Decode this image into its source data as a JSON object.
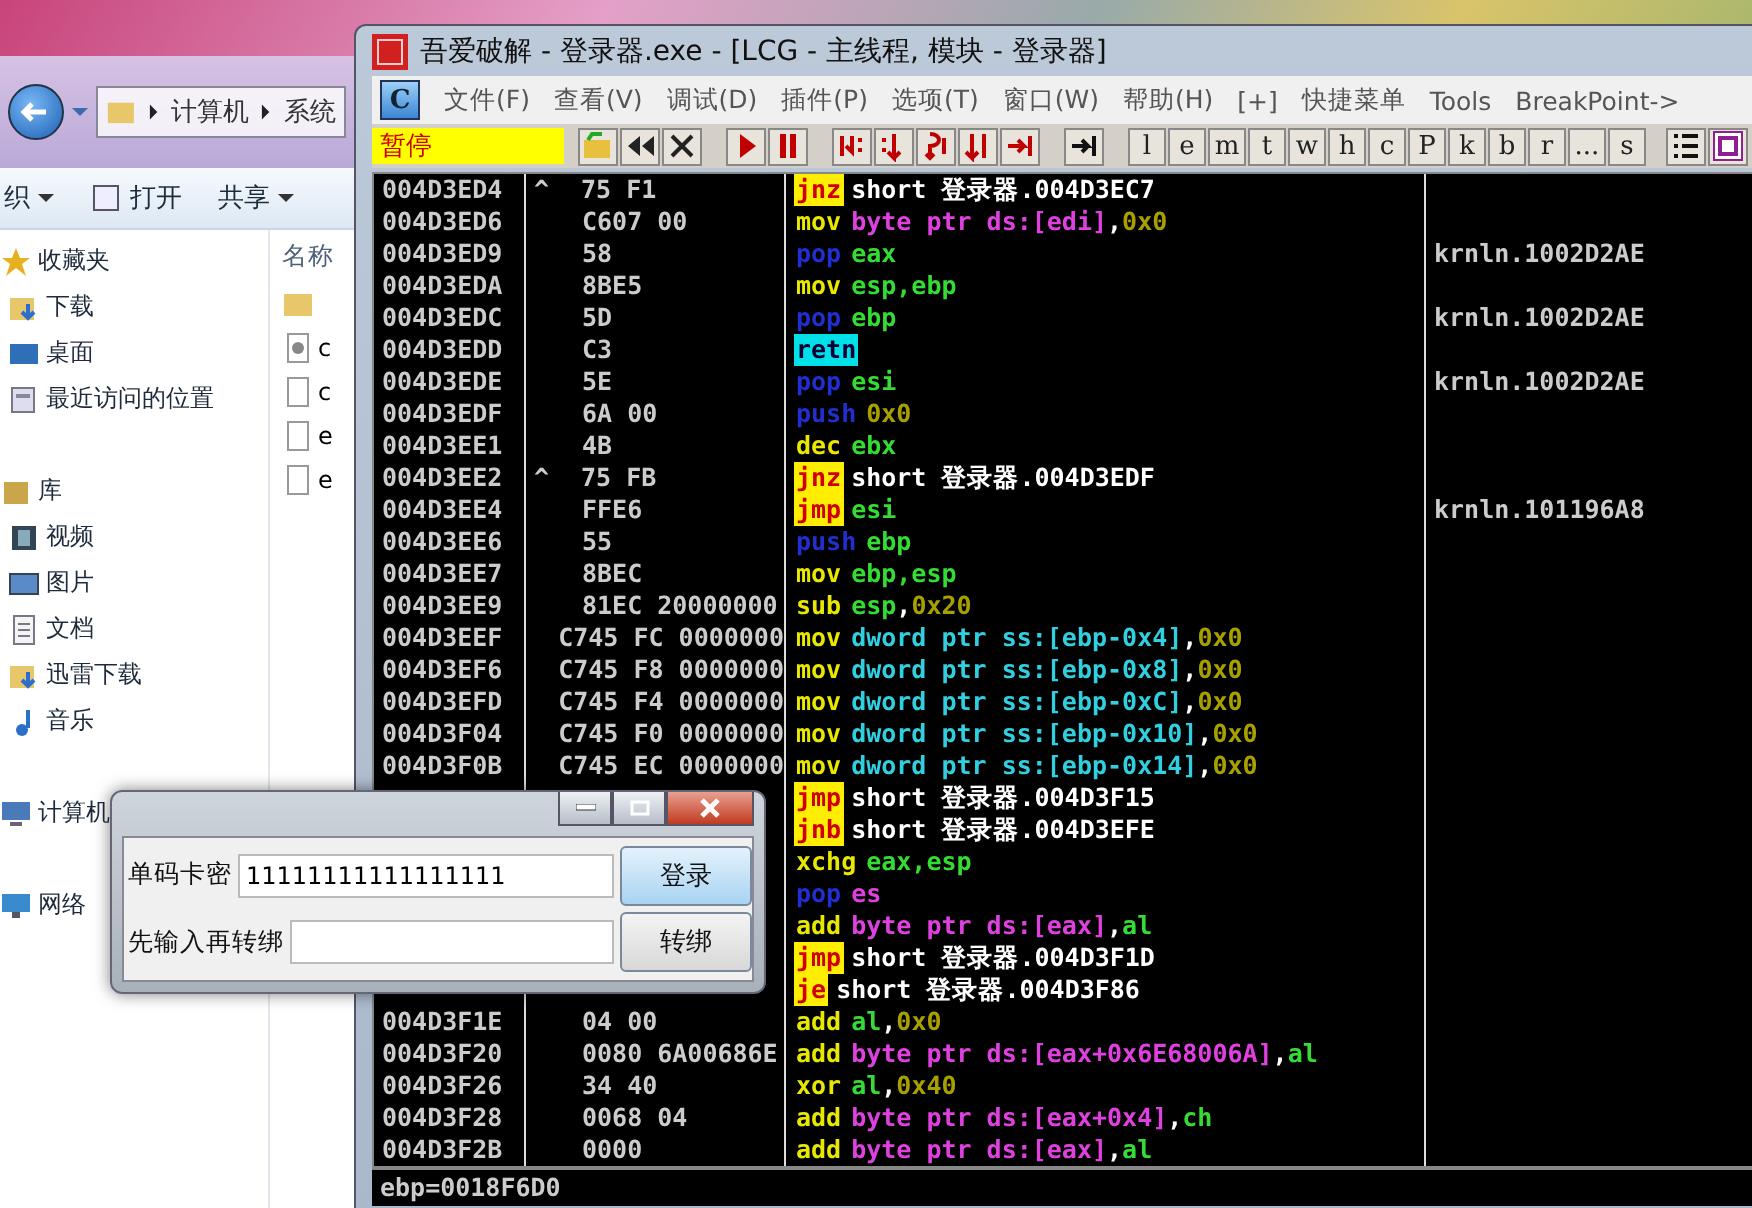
{
  "explorer": {
    "address": [
      "计算机",
      "系统"
    ],
    "toolbar": [
      {
        "label": "织",
        "caret": true
      },
      {
        "label": "打开",
        "caret": false
      },
      {
        "label": "共享",
        "caret": true
      }
    ],
    "nav_groups": [
      {
        "label": "收藏夹",
        "kind": "favorites",
        "items": [
          {
            "label": "下载",
            "kind": "download"
          },
          {
            "label": "桌面",
            "kind": "desktop"
          },
          {
            "label": "最近访问的位置",
            "kind": "recent"
          }
        ]
      },
      {
        "label": "库",
        "kind": "library",
        "items": [
          {
            "label": "视频",
            "kind": "video"
          },
          {
            "label": "图片",
            "kind": "picture"
          },
          {
            "label": "文档",
            "kind": "document"
          },
          {
            "label": "迅雷下载",
            "kind": "download"
          },
          {
            "label": "音乐",
            "kind": "music"
          }
        ]
      },
      {
        "label": "计算机",
        "kind": "computer"
      },
      {
        "label": "网络",
        "kind": "network"
      }
    ],
    "column_header": "名称",
    "files": [
      {
        "kind": "folder"
      },
      {
        "name": "c",
        "kind": "settings"
      },
      {
        "name": "c",
        "kind": "file"
      },
      {
        "name": "e",
        "kind": "file"
      },
      {
        "name": "e",
        "kind": "file"
      }
    ]
  },
  "debugger": {
    "title": "吾爱破解 - 登录器.exe - [LCG - 主线程, 模块 - 登录器]",
    "logo_letter": "C",
    "menu": [
      "文件(F)",
      "查看(V)",
      "调试(D)",
      "插件(P)",
      "选项(T)",
      "窗口(W)",
      "帮助(H)",
      "[+]",
      "快捷菜单",
      "Tools",
      "BreakPoint->"
    ],
    "status": "暂停",
    "letter_buttons": [
      "l",
      "e",
      "m",
      "t",
      "w",
      "h",
      "c",
      "P",
      "k",
      "b",
      "r",
      "...",
      "s"
    ],
    "rows": [
      {
        "address": "004D3ED4",
        "mark": "^",
        "hex": "75 F1",
        "mnemonic": "jnz",
        "kind": "jump",
        "ops": [
          {
            "text": "short 登录器.004D3EC7",
            "kind": "target"
          }
        ]
      },
      {
        "address": "004D3ED6",
        "hex": "C607 00",
        "mnemonic": "mov",
        "kind": "normal",
        "ops": [
          {
            "text": "byte ptr ds:[edi]",
            "kind": "mem"
          },
          {
            "text": ",",
            "kind": "sep"
          },
          {
            "text": "0x0",
            "kind": "imm"
          }
        ]
      },
      {
        "address": "004D3ED9",
        "hex": "58",
        "mnemonic": "pop",
        "kind": "stack",
        "ops": [
          {
            "text": "eax",
            "kind": "reg"
          }
        ],
        "comment": "krnln.1002D2AE"
      },
      {
        "address": "004D3EDA",
        "hex": "8BE5",
        "mnemonic": "mov",
        "kind": "normal",
        "ops": [
          {
            "text": "esp,ebp",
            "kind": "reg"
          }
        ]
      },
      {
        "address": "004D3EDC",
        "hex": "5D",
        "mnemonic": "pop",
        "kind": "stack",
        "ops": [
          {
            "text": "ebp",
            "kind": "reg"
          }
        ],
        "comment": "krnln.1002D2AE"
      },
      {
        "address": "004D3EDD",
        "hex": "C3",
        "mnemonic": "retn",
        "kind": "ret",
        "ops": []
      },
      {
        "address": "004D3EDE",
        "hex": "5E",
        "mnemonic": "pop",
        "kind": "stack",
        "ops": [
          {
            "text": "esi",
            "kind": "reg"
          }
        ],
        "comment": "krnln.1002D2AE"
      },
      {
        "address": "004D3EDF",
        "hex": "6A 00",
        "mnemonic": "push",
        "kind": "stack",
        "ops": [
          {
            "text": "0x0",
            "kind": "imm"
          }
        ]
      },
      {
        "address": "004D3EE1",
        "hex": "4B",
        "mnemonic": "dec",
        "kind": "normal",
        "ops": [
          {
            "text": "ebx",
            "kind": "reg"
          }
        ]
      },
      {
        "address": "004D3EE2",
        "mark": "^",
        "hex": "75 FB",
        "mnemonic": "jnz",
        "kind": "jump",
        "ops": [
          {
            "text": "short 登录器.004D3EDF",
            "kind": "target"
          }
        ]
      },
      {
        "address": "004D3EE4",
        "hex": "FFE6",
        "mnemonic": "jmp",
        "kind": "jump",
        "ops": [
          {
            "text": "esi",
            "kind": "reg"
          }
        ],
        "comment": "krnln.101196A8"
      },
      {
        "address": "004D3EE6",
        "hex": "55",
        "mnemonic": "push",
        "kind": "stack",
        "ops": [
          {
            "text": "ebp",
            "kind": "reg"
          }
        ]
      },
      {
        "address": "004D3EE7",
        "hex": "8BEC",
        "mnemonic": "mov",
        "kind": "normal",
        "ops": [
          {
            "text": "ebp,esp",
            "kind": "reg"
          }
        ]
      },
      {
        "address": "004D3EE9",
        "hex": "81EC 20000000",
        "mnemonic": "sub",
        "kind": "normal",
        "ops": [
          {
            "text": "esp",
            "kind": "reg"
          },
          {
            "text": ",",
            "kind": "sep"
          },
          {
            "text": "0x20",
            "kind": "imm"
          }
        ]
      },
      {
        "address": "004D3EEF",
        "hex": "C745 FC 0000000",
        "mnemonic": "mov",
        "kind": "normal",
        "ops": [
          {
            "text": "dword ptr ss:[ebp-0x4]",
            "kind": "dword"
          },
          {
            "text": ",",
            "kind": "sep"
          },
          {
            "text": "0x0",
            "kind": "imm"
          }
        ]
      },
      {
        "address": "004D3EF6",
        "hex": "C745 F8 0000000",
        "mnemonic": "mov",
        "kind": "normal",
        "ops": [
          {
            "text": "dword ptr ss:[ebp-0x8]",
            "kind": "dword"
          },
          {
            "text": ",",
            "kind": "sep"
          },
          {
            "text": "0x0",
            "kind": "imm"
          }
        ]
      },
      {
        "address": "004D3EFD",
        "hex": "C745 F4 0000000",
        "mnemonic": "mov",
        "kind": "normal",
        "ops": [
          {
            "text": "dword ptr ss:[ebp-0xC]",
            "kind": "dword"
          },
          {
            "text": ",",
            "kind": "sep"
          },
          {
            "text": "0x0",
            "kind": "imm"
          }
        ]
      },
      {
        "address": "004D3F04",
        "hex": "C745 F0 0000000",
        "mnemonic": "mov",
        "kind": "normal",
        "ops": [
          {
            "text": "dword ptr ss:[ebp-0x10]",
            "kind": "dword"
          },
          {
            "text": ",",
            "kind": "sep"
          },
          {
            "text": "0x0",
            "kind": "imm"
          }
        ]
      },
      {
        "address": "004D3F0B",
        "hex": "C745 EC 0000000",
        "mnemonic": "mov",
        "kind": "normal",
        "ops": [
          {
            "text": "dword ptr ss:[ebp-0x14]",
            "kind": "dword"
          },
          {
            "text": ",",
            "kind": "sep"
          },
          {
            "text": "0x0",
            "kind": "imm"
          }
        ]
      },
      {
        "mnemonic": "jmp",
        "kind": "jump",
        "ops": [
          {
            "text": "short 登录器.004D3F15",
            "kind": "target"
          }
        ]
      },
      {
        "mnemonic": "jnb",
        "kind": "jump",
        "ops": [
          {
            "text": "short 登录器.004D3EFE",
            "kind": "target"
          }
        ]
      },
      {
        "mnemonic": "xchg",
        "kind": "normal",
        "ops": [
          {
            "text": "eax,esp",
            "kind": "reg"
          }
        ]
      },
      {
        "mnemonic": "pop",
        "kind": "stack",
        "ops": [
          {
            "text": "es",
            "kind": "mem"
          }
        ]
      },
      {
        "mnemonic": "add",
        "kind": "normal",
        "ops": [
          {
            "text": "byte ptr ds:[eax]",
            "kind": "mem"
          },
          {
            "text": ",",
            "kind": "sep"
          },
          {
            "text": "al",
            "kind": "reg"
          }
        ]
      },
      {
        "mnemonic": "jmp",
        "kind": "jump",
        "ops": [
          {
            "text": "short 登录器.004D3F1D",
            "kind": "target"
          }
        ]
      },
      {
        "mnemonic": "je",
        "kind": "jump",
        "ops": [
          {
            "text": "short 登录器.004D3F86",
            "kind": "target"
          }
        ]
      },
      {
        "address": "004D3F1E",
        "hex": "04 00",
        "mnemonic": "add",
        "kind": "normal",
        "ops": [
          {
            "text": "al",
            "kind": "reg"
          },
          {
            "text": ",",
            "kind": "sep"
          },
          {
            "text": "0x0",
            "kind": "imm"
          }
        ]
      },
      {
        "address": "004D3F20",
        "hex": "0080 6A00686E",
        "mnemonic": "add",
        "kind": "normal",
        "ops": [
          {
            "text": "byte ptr ds:[eax+0x6E68006A]",
            "kind": "mem"
          },
          {
            "text": ",",
            "kind": "sep"
          },
          {
            "text": "al",
            "kind": "reg"
          }
        ]
      },
      {
        "address": "004D3F26",
        "hex": "34 40",
        "mnemonic": "xor",
        "kind": "normal",
        "ops": [
          {
            "text": "al",
            "kind": "reg"
          },
          {
            "text": ",",
            "kind": "sep"
          },
          {
            "text": "0x40",
            "kind": "imm"
          }
        ]
      },
      {
        "address": "004D3F28",
        "hex": "0068 04",
        "mnemonic": "add",
        "kind": "normal",
        "ops": [
          {
            "text": "byte ptr ds:[eax+0x4]",
            "kind": "mem"
          },
          {
            "text": ",",
            "kind": "sep"
          },
          {
            "text": "ch",
            "kind": "reg"
          }
        ]
      },
      {
        "address": "004D3F2B",
        "hex": "0000",
        "mnemonic": "add",
        "kind": "normal",
        "ops": [
          {
            "text": "byte ptr ds:[eax]",
            "kind": "mem"
          },
          {
            "text": ",",
            "kind": "sep"
          },
          {
            "text": "al",
            "kind": "reg"
          }
        ]
      }
    ],
    "info": "ebp=0018F6D0"
  },
  "login_dialog": {
    "fields": [
      {
        "label": "单码卡密",
        "value": "11111111111111111",
        "button": "登录",
        "primary": true
      },
      {
        "label": "先输入再转绑",
        "button": "转绑",
        "primary": false
      }
    ]
  }
}
